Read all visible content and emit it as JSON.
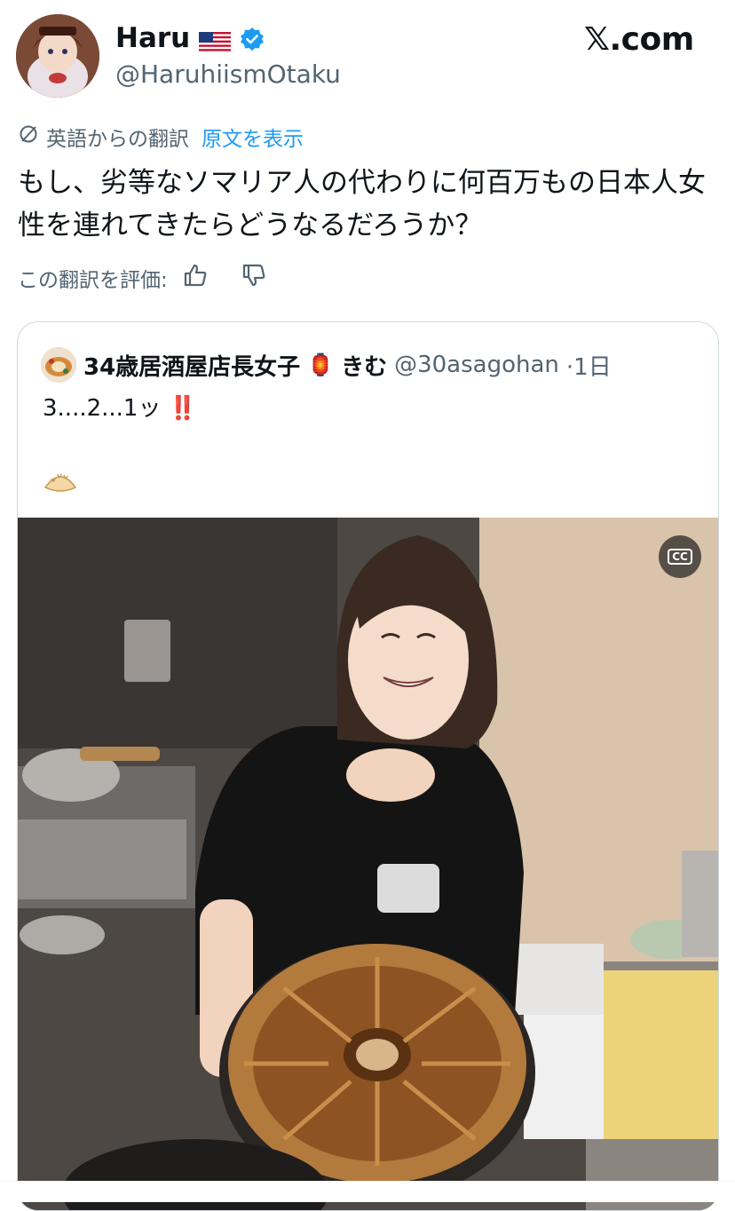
{
  "author": {
    "display_name": "Haru",
    "handle": "@HaruhiismOtaku",
    "flag_icon": "us-flag-icon",
    "verified_color": "#1d9bf0"
  },
  "brand": {
    "site": "𝕏.com"
  },
  "translation": {
    "source_label": "英語からの翻訳",
    "show_original": "原文を表示",
    "text": "もし、劣等なソマリア人の代わりに何百万もの日本人女性を連れてきたらどうなるだろうか？",
    "rate_label": "この翻訳を評価:"
  },
  "quoted_post": {
    "display_name": "34歳居酒屋店長女子",
    "name_emoji": "🏮",
    "name_suffix": "きむ",
    "handle": "@30asagohan",
    "time": "·1日",
    "text": "3....2...1ッ",
    "text_emoji": "‼️",
    "extra_emoji": "🥟",
    "media": {
      "cc_label": "CC"
    }
  },
  "colors": {
    "link": "#1d9bf0",
    "secondary": "#536471",
    "border": "#cfd9de"
  }
}
